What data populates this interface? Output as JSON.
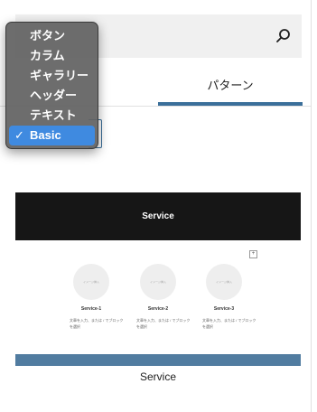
{
  "search": {
    "value": "",
    "placeholder": ""
  },
  "tabs": [
    {
      "label": ""
    },
    {
      "label": "パターン"
    }
  ],
  "category_menu": {
    "options": [
      "ボタン",
      "カラム",
      "ギャラリー",
      "ヘッダー",
      "テキスト",
      "Basic"
    ],
    "selected": "Basic",
    "check_mark": "✓"
  },
  "pattern_preview": {
    "hero_title": "Service",
    "mini_button": "+",
    "cards": [
      {
        "image_label": "イメージ挿入",
        "title": "Service-1",
        "text": "文章を入力、または / でブロックを選択"
      },
      {
        "image_label": "イメージ挿入",
        "title": "Service-2",
        "text": "文章を入力、または / でブロックを選択"
      },
      {
        "image_label": "イメージ挿入",
        "title": "Service-3",
        "text": "文章を入力、または / でブロックを選択"
      }
    ],
    "band_color": "#517ca0"
  },
  "pattern_caption": "Service",
  "colors": {
    "accent": "#3b6f9a",
    "menu_bg": "#626262",
    "menu_highlight": "#3f8ae0"
  }
}
